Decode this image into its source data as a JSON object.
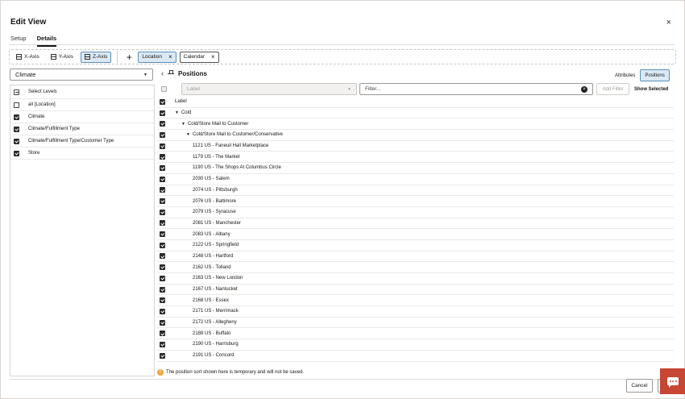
{
  "dialog": {
    "title": "Edit View",
    "close_glyph": "×"
  },
  "tabs": [
    {
      "label": "Setup",
      "active": false
    },
    {
      "label": "Details",
      "active": true
    }
  ],
  "axes": {
    "x_label": "X-Axis",
    "y_label": "Y-Axis",
    "z_label": "Z-Axis",
    "active": "Z-Axis"
  },
  "add_glyph": "+",
  "chips": [
    {
      "label": "Location",
      "selected": true
    },
    {
      "label": "Calendar",
      "selected": false
    }
  ],
  "chip_remove_glyph": "×",
  "hierarchy_select": {
    "value": "Climate"
  },
  "levels": {
    "header": "Select Levels",
    "items": [
      {
        "label": "all [Location]",
        "checked": false
      },
      {
        "label": "Climate",
        "checked": true
      },
      {
        "label": "Climate/Fulfillment Type",
        "checked": true
      },
      {
        "label": "Climate/Fulfillment Type/Customer Type",
        "checked": true
      },
      {
        "label": "Store",
        "checked": true
      }
    ]
  },
  "positions": {
    "back_glyph": "‹",
    "title": "Positions",
    "view_toggle": {
      "attributes": "Attributes",
      "positions": "Positions",
      "selected": "Positions"
    },
    "label_select_placeholder": "Label",
    "filter_placeholder": "Filter...",
    "clear_glyph": "×",
    "add_filter": "Add Filter",
    "show_selected": "Show Selected",
    "column_header": "Label",
    "rows": [
      {
        "label": "Cold",
        "level": 1,
        "expanded": true
      },
      {
        "label": "Cold/Store Mail to Customer",
        "level": 2,
        "expanded": true
      },
      {
        "label": "Cold/Store Mail to Customer/Conservative",
        "level": 3,
        "expanded": true
      },
      {
        "label": "1121 US - Faneuil Hall Marketplace",
        "level": 4
      },
      {
        "label": "1179 US - The Market",
        "level": 4
      },
      {
        "label": "1190 US - The Shops At Columbus Circle",
        "level": 4
      },
      {
        "label": "2030 US - Salem",
        "level": 4
      },
      {
        "label": "2074 US - Pittsburgh",
        "level": 4
      },
      {
        "label": "2076 US - Baltimore",
        "level": 4
      },
      {
        "label": "2079 US - Syracuse",
        "level": 4
      },
      {
        "label": "2081 US - Manchester",
        "level": 4
      },
      {
        "label": "2083 US - Albany",
        "level": 4
      },
      {
        "label": "2122 US - Springfield",
        "level": 4
      },
      {
        "label": "2148 US - Hartford",
        "level": 4
      },
      {
        "label": "2162 US - Tolland",
        "level": 4
      },
      {
        "label": "2163 US - New London",
        "level": 4
      },
      {
        "label": "2167 US - Nantucket",
        "level": 4
      },
      {
        "label": "2168 US - Essex",
        "level": 4
      },
      {
        "label": "2171 US - Merrimack",
        "level": 4
      },
      {
        "label": "2172 US - Allegheny",
        "level": 4
      },
      {
        "label": "2188 US - Buffalo",
        "level": 4
      },
      {
        "label": "2190 US - Harrisburg",
        "level": 4
      },
      {
        "label": "2191 US - Concord",
        "level": 4
      }
    ]
  },
  "note": "The position sort shown here is temporary and will not be saved.",
  "note_icon_glyph": "!",
  "buttons": {
    "cancel": "Cancel"
  },
  "colors": {
    "accent": "#dbe9f4",
    "accent_border": "#5c8fb8",
    "chat": "#c74634",
    "info": "#f2a33a"
  }
}
